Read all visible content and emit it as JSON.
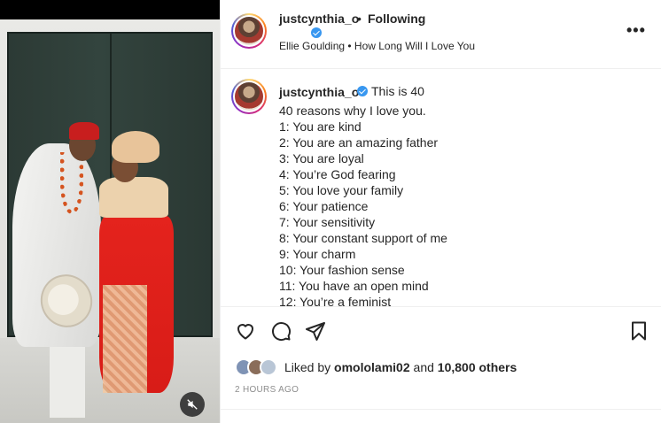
{
  "header": {
    "username": "justcynthia_o",
    "separator": "•",
    "follow_status": "Following",
    "audio": "Ellie Goulding • How Long Will I Love You",
    "more_label": "•••"
  },
  "caption": {
    "username": "justcynthia_o",
    "lead": "This is 40",
    "lines": [
      "40 reasons why I love you.",
      "1: You are kind",
      "2: You are an amazing father",
      "3: You are loyal",
      "4: You’re God fearing",
      "5: You love your family",
      "6: Your patience",
      "7: Your sensitivity",
      "8: Your constant support of me",
      "9: Your charm",
      "10: Your fashion sense",
      "11: You have an open mind",
      "12: You’re a feminist"
    ]
  },
  "likes": {
    "prefix": "Liked by",
    "user": "omololami02",
    "middle": "and",
    "count": "10,800 others"
  },
  "timestamp": "2 HOURS AGO",
  "icons": {
    "like": "heart-icon",
    "comment": "comment-icon",
    "share": "paper-plane-icon",
    "save": "bookmark-icon",
    "mute": "speaker-muted-icon",
    "verified": "verified-badge-icon"
  },
  "colors": {
    "verified": "#3897f0",
    "text": "#262626",
    "muted": "#8e8e8e"
  }
}
